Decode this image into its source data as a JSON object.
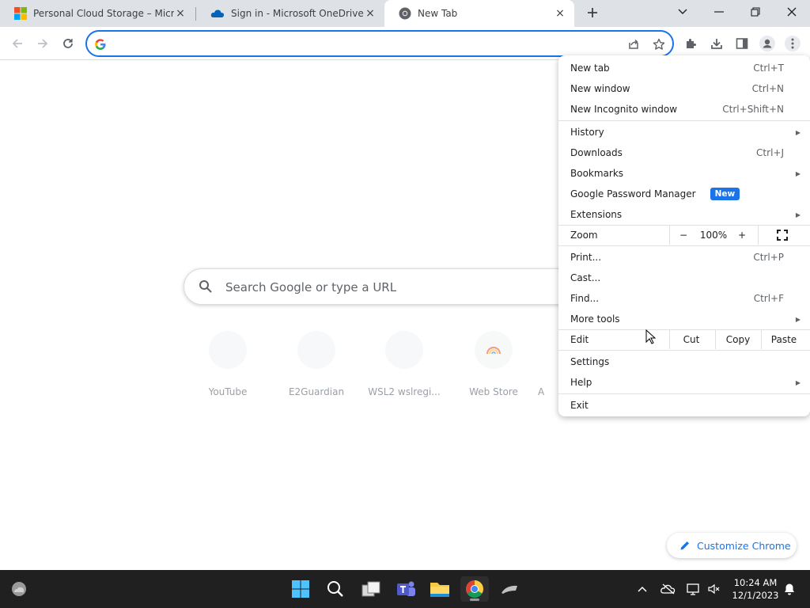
{
  "tabs": [
    {
      "title": "Personal Cloud Storage – Microsoft",
      "icon": "microsoft-logo-icon",
      "active": false
    },
    {
      "title": "Sign in - Microsoft OneDrive",
      "icon": "onedrive-cloud-icon",
      "active": false
    },
    {
      "title": "New Tab",
      "icon": "chrome-icon",
      "active": true
    }
  ],
  "tab_close_glyph": "×",
  "omnibox": {
    "value": "",
    "placeholder": ""
  },
  "ntp": {
    "search_placeholder": "Search Google or type a URL",
    "shortcuts": [
      "YouTube",
      "E2Guardian",
      "WSL2 wslregi...",
      "Web Store",
      "A"
    ],
    "customize_label": "Customize Chrome"
  },
  "menu": {
    "new_tab": {
      "label": "New tab",
      "shortcut": "Ctrl+T"
    },
    "new_window": {
      "label": "New window",
      "shortcut": "Ctrl+N"
    },
    "new_incognito": {
      "label": "New Incognito window",
      "shortcut": "Ctrl+Shift+N"
    },
    "history": {
      "label": "History"
    },
    "downloads": {
      "label": "Downloads",
      "shortcut": "Ctrl+J"
    },
    "bookmarks": {
      "label": "Bookmarks"
    },
    "password_manager": {
      "label": "Google Password Manager",
      "badge": "New"
    },
    "extensions": {
      "label": "Extensions"
    },
    "zoom": {
      "label": "Zoom",
      "minus": "−",
      "value": "100%",
      "plus": "+"
    },
    "print": {
      "label": "Print...",
      "shortcut": "Ctrl+P"
    },
    "cast": {
      "label": "Cast..."
    },
    "find": {
      "label": "Find...",
      "shortcut": "Ctrl+F"
    },
    "more_tools": {
      "label": "More tools"
    },
    "edit": {
      "label": "Edit",
      "cut": "Cut",
      "copy": "Copy",
      "paste": "Paste"
    },
    "settings": {
      "label": "Settings"
    },
    "help": {
      "label": "Help"
    },
    "exit": {
      "label": "Exit"
    },
    "submenu_arrow": "▶"
  },
  "taskbar": {
    "time": "10:24 AM",
    "date": "12/1/2023",
    "apps": [
      "start-icon",
      "search-icon",
      "task-view-icon",
      "teams-icon",
      "file-explorer-icon",
      "chrome-icon",
      "app-icon"
    ]
  },
  "colors": {
    "accent": "#1a73e8",
    "tabstrip": "#dee1e6",
    "taskbar": "#202020"
  }
}
